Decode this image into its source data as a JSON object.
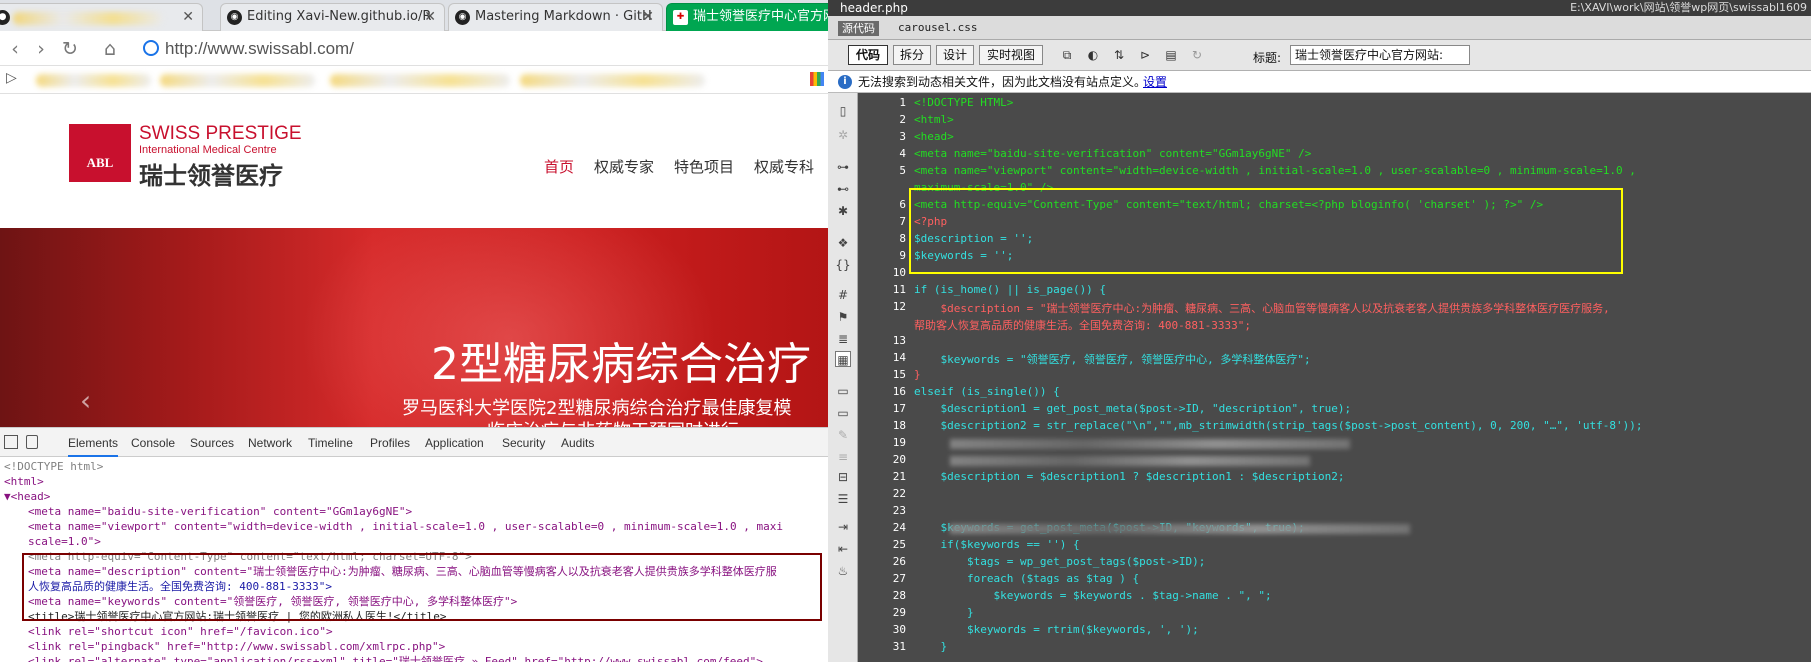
{
  "browser": {
    "tabs": [
      {
        "label": "",
        "icon": "chrome-icon"
      },
      {
        "label": "Editing Xavi-New.github.io/R",
        "icon": "github-icon"
      },
      {
        "label": "Mastering Markdown · GitH",
        "icon": "github-icon"
      },
      {
        "label": "瑞士领誉医疗中心官方网",
        "icon": "abl-icon"
      }
    ],
    "url": "http://www.swissabl.com/",
    "site": {
      "logo_mark": "ABL",
      "logo_en": "SWISS PRESTIGE",
      "logo_en_sub": "International Medical Centre",
      "logo_cn": "瑞士领誉医疗",
      "menu": [
        "首页",
        "权威专家",
        "特色项目",
        "权威专科"
      ],
      "banner_title": "2型糖尿病综合治疗",
      "banner_sub": "罗马医科大学医院2型糖尿病综合治疗最佳康复模",
      "banner_sub2": "临床治疗与非药物干预同时进行"
    },
    "devtools": {
      "tabs": [
        "Elements",
        "Console",
        "Sources",
        "Network",
        "Timeline",
        "Profiles",
        "Application",
        "Security",
        "Audits"
      ],
      "active_tab": "Elements",
      "lines": [
        "<!DOCTYPE html>",
        "<html>",
        "▼<head>",
        "<meta name=\"baidu-site-verification\" content=\"GGm1ay6gNE\">",
        "<meta name=\"viewport\" content=\"width=device-width , initial-scale=1.0 , user-scalable=0 , minimum-scale=1.0 , maxi",
        "scale=1.0\">",
        "<meta http-equiv=\"Content-Type\" content=\"text/html; charset=UTF-8\">",
        "<meta name=\"description\" content=\"瑞士领誉医疗中心:为肿瘤、糖尿病、三高、心脑血管等慢病客人以及抗衰老客人提供贵族多学科整体医疗服",
        "人恢复高品质的健康生活。全国免费咨询: 400-881-3333\">",
        "<meta name=\"keywords\" content=\"领誉医疗, 领誉医疗, 领誉医疗中心, 多学科整体医疗\">",
        "<title>瑞士领誉医疗中心官方网站:瑞士领誉医疗 | 您的欧洲私人医生!</title>",
        "<link rel=\"shortcut icon\" href=\"/favicon.ico\">",
        "<link rel=\"pingback\" href=\"http://www.swissabl.com/xmlrpc.php\">",
        "<link rel=\"alternate\" type=\"application/rss+xml\" title=\"瑞士领誉医疗 » Feed\" href=\"http://www.swissabl.com/feed\">"
      ]
    }
  },
  "editor": {
    "file_tab": "header.php",
    "path": "E:\\XAVI\\work\\网站\\领誉wp网页\\swissabl1609",
    "source_label": "源代码",
    "related_file": "carousel.css",
    "view_buttons": [
      "代码",
      "拆分",
      "设计",
      "实时视图"
    ],
    "title_label": "标题:",
    "title_value": "瑞士领誉医疗中心官方网站:",
    "info_text": "无法搜索到动态相关文件，因为此文档没有站点定义。",
    "info_link": "设置",
    "lines": [
      {
        "n": "1",
        "t": "<!DOCTYPE HTML>"
      },
      {
        "n": "2",
        "t": "<html>"
      },
      {
        "n": "3",
        "t": "<head>"
      },
      {
        "n": "4",
        "t": "<meta name=\"baidu-site-verification\" content=\"GGm1ay6gNE\" />"
      },
      {
        "n": "5",
        "t": "<meta name=\"viewport\" content=\"width=device-width , initial-scale=1.0 , user-scalable=0 , minimum-scale=1.0 ,"
      },
      {
        "n": "",
        "t": "maximum-scale=1.0\" />"
      },
      {
        "n": "6",
        "t": "<meta http-equiv=\"Content-Type\" content=\"text/html; charset=<?php bloginfo( 'charset' ); ?>\" />"
      },
      {
        "n": "7",
        "t": "<?php"
      },
      {
        "n": "8",
        "t": "$description = '';"
      },
      {
        "n": "9",
        "t": "$keywords = '';"
      },
      {
        "n": "10",
        "t": ""
      },
      {
        "n": "11",
        "t": "if (is_home() || is_page()) {"
      },
      {
        "n": "12",
        "t": "    $description = \"瑞士领誉医疗中心:为肿瘤、糖尿病、三高、心脑血管等慢病客人以及抗衰老客人提供贵族多学科整体医疗医疗服务,"
      },
      {
        "n": "",
        "t": "帮助客人恢复高品质的健康生活。全国免费咨询: 400-881-3333\";"
      },
      {
        "n": "13",
        "t": ""
      },
      {
        "n": "14",
        "t": "    $keywords = \"领誉医疗, 领誉医疗, 领誉医疗中心, 多学科整体医疗\";"
      },
      {
        "n": "15",
        "t": "}"
      },
      {
        "n": "16",
        "t": "elseif (is_single()) {"
      },
      {
        "n": "17",
        "t": "    $description1 = get_post_meta($post->ID, \"description\", true);"
      },
      {
        "n": "18",
        "t": "    $description2 = str_replace(\"\\n\",\"\",mb_strimwidth(strip_tags($post->post_content), 0, 200, \"…\", 'utf-8'));"
      },
      {
        "n": "19",
        "t": ""
      },
      {
        "n": "20",
        "t": ""
      },
      {
        "n": "21",
        "t": "    $description = $description1 ? $description1 : $description2;"
      },
      {
        "n": "22",
        "t": ""
      },
      {
        "n": "23",
        "t": ""
      },
      {
        "n": "24",
        "t": "    $keywords = get_post_meta($post->ID, \"keywords\", true);"
      },
      {
        "n": "25",
        "t": "    if($keywords == '') {"
      },
      {
        "n": "26",
        "t": "        $tags = wp_get_post_tags($post->ID);"
      },
      {
        "n": "27",
        "t": "        foreach ($tags as $tag ) {"
      },
      {
        "n": "28",
        "t": "            $keywords = $keywords . $tag->name . \", \";"
      },
      {
        "n": "29",
        "t": "        }"
      },
      {
        "n": "30",
        "t": "        $keywords = rtrim($keywords, ', ');"
      },
      {
        "n": "31",
        "t": "    }"
      }
    ]
  },
  "colors": {
    "brand_red": "#c8102e",
    "highlight_box": "#ffff00",
    "devtools_box": "#7a0000",
    "editor_bg": "#4a4a4a"
  }
}
